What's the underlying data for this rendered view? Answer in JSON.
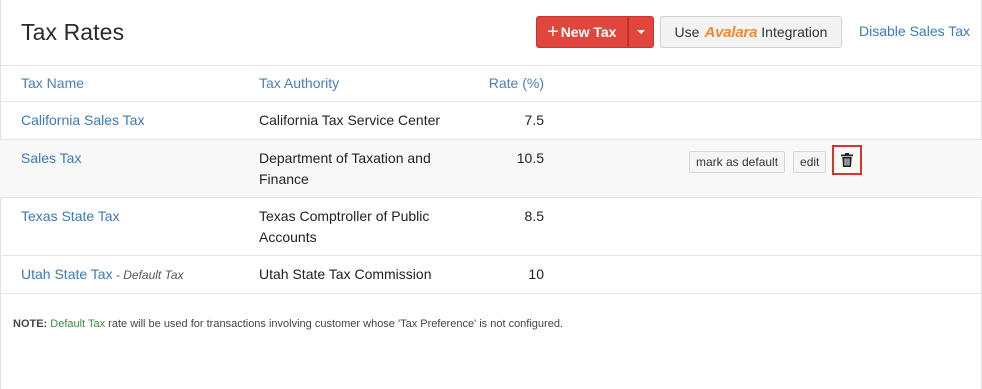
{
  "header": {
    "title": "Tax Rates",
    "new_tax_plus": "+",
    "new_tax_label": "New Tax",
    "avalara_use": "Use",
    "avalara_brand": "Avalara",
    "avalara_integration": "Integration",
    "disable_link": "Disable Sales Tax"
  },
  "table": {
    "columns": [
      "Tax Name",
      "Tax Authority",
      "Rate (%)"
    ],
    "rows": [
      {
        "name": "California Sales Tax",
        "default_tag": "",
        "authority": "California Tax Service Center",
        "rate": "7.5"
      },
      {
        "name": "Sales Tax",
        "default_tag": "",
        "authority": "Department of Taxation and Finance",
        "rate": "10.5"
      },
      {
        "name": "Texas State Tax",
        "default_tag": "",
        "authority": "Texas Comptroller of Public Accounts",
        "rate": "8.5"
      },
      {
        "name": "Utah State Tax",
        "default_tag": " - Default Tax",
        "authority": "Utah State Tax Commission",
        "rate": "10"
      }
    ],
    "row_actions": {
      "mark_default": "mark as default",
      "edit": "edit"
    }
  },
  "note": {
    "label": "NOTE:",
    "highlight": "Default Tax",
    "text": " rate will be used for transactions involving customer whose 'Tax Preference' is not configured."
  },
  "colors": {
    "primary_button": "#e0463c",
    "link": "#3a7ab8",
    "avalara_brand": "#f0892d",
    "highlight_box": "#d9342b"
  },
  "icons": [
    "plus-icon",
    "caret-down-icon",
    "trash-icon"
  ]
}
